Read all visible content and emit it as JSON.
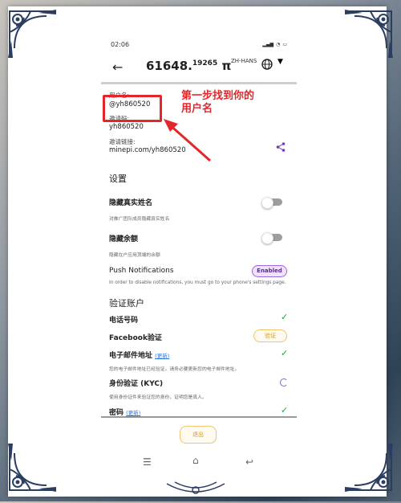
{
  "status": {
    "time": "02:06"
  },
  "appbar": {
    "balance_int": "61648.",
    "balance_dec": "19265",
    "pi_symbol": "π",
    "language": "ZH-HANS"
  },
  "profile": {
    "username_label": "用户名:",
    "username_value": "@yh860520",
    "referral_label": "邀请码:",
    "referral_value": "yh860520",
    "invite_link_label": "邀请链接:",
    "invite_link_value": "minepi.com/yh860520"
  },
  "settings": {
    "heading": "设置",
    "hide_name_title": "隐藏真实姓名",
    "hide_name_desc": "对推广团队成员隐藏真实姓名",
    "hide_balance_title": "隐藏余额",
    "hide_balance_desc": "隐藏在户应用顶端的余额",
    "push_title": "Push Notifications",
    "push_badge": "Enabled",
    "push_desc": "In order to disable notifications, you must go to your phone's settings page.",
    "hide_name_on": false,
    "hide_balance_on": false
  },
  "verify": {
    "heading": "验证账户",
    "phone_label": "电话号码",
    "facebook_label": "Facebook验证",
    "facebook_button": "验证",
    "email_label": "电子邮件地址",
    "email_update": "(更新)",
    "email_desc": "您的电子邮件地址已经验证。请务必要更新您的电子邮件地址。",
    "kyc_label": "身份验证 (KYC)",
    "kyc_desc": "使用身份证件来验证您的身份，证明您是真人。",
    "password_label": "密码",
    "password_update": "(更新)"
  },
  "logout_label": "退出",
  "annotation": {
    "line1": "第一步找到你的",
    "line2": "用户名"
  },
  "colors": {
    "accent_purple": "#8e5bd6",
    "check_green": "#1aa33f",
    "annotation_red": "#e3262a",
    "gold": "#f0c36d"
  }
}
